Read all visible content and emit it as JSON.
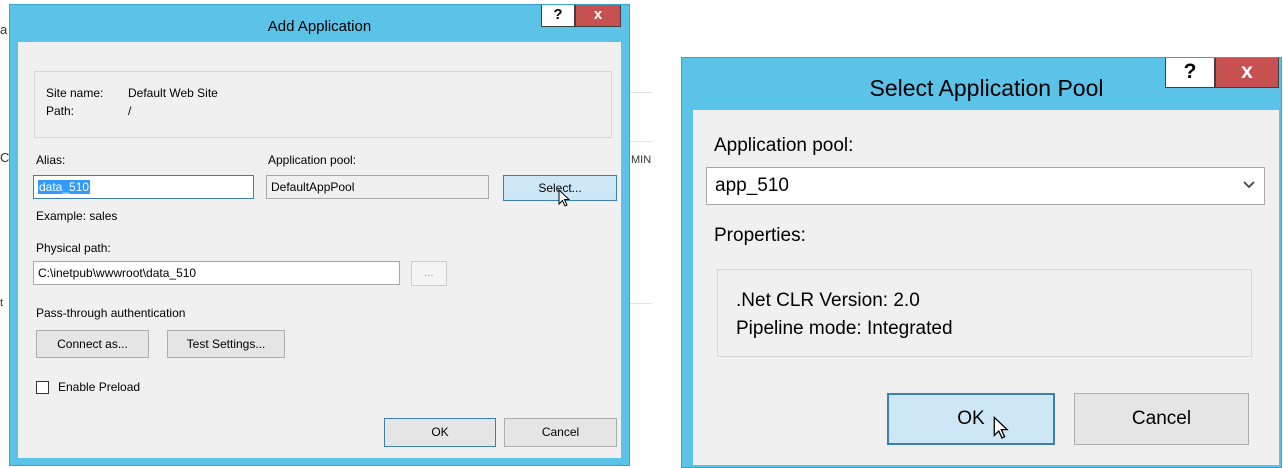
{
  "add_dialog": {
    "title": "Add Application",
    "help": "?",
    "close": "x",
    "site_name_label": "Site name:",
    "site_name_value": "Default Web Site",
    "path_label": "Path:",
    "path_value": "/",
    "alias_label": "Alias:",
    "alias_value": "data_510",
    "app_pool_label": "Application pool:",
    "app_pool_value": "DefaultAppPool",
    "select_button": "Select...",
    "example_text": "Example: sales",
    "physical_path_label": "Physical path:",
    "physical_path_value": "C:\\inetpub\\wwwroot\\data_510",
    "browse_button": "...",
    "passthrough_label": "Pass-through authentication",
    "connect_as_button": "Connect as...",
    "test_settings_button": "Test Settings...",
    "enable_preload_label": "Enable Preload",
    "enable_preload_checked": false,
    "ok_button": "OK",
    "cancel_button": "Cancel"
  },
  "pool_dialog": {
    "title": "Select Application Pool",
    "help": "?",
    "close": "x",
    "app_pool_label": "Application pool:",
    "app_pool_selected": "app_510",
    "properties_label": "Properties:",
    "clr_version": ".Net CLR Version: 2.0",
    "pipeline_mode": "Pipeline mode: Integrated",
    "ok_button": "OK",
    "cancel_button": "Cancel"
  },
  "background": {
    "frag_a": "a",
    "frag_c": "C",
    "frag_min": "MIN",
    "frag_t": "t"
  },
  "colors": {
    "title_bar": "#5bc3e8",
    "close_button": "#c75050",
    "selection": "#3399ff",
    "hover_button": "#cde7f7"
  },
  "icons": {
    "cursor": "mouse-pointer-icon",
    "dropdown": "chevron-down-icon"
  }
}
